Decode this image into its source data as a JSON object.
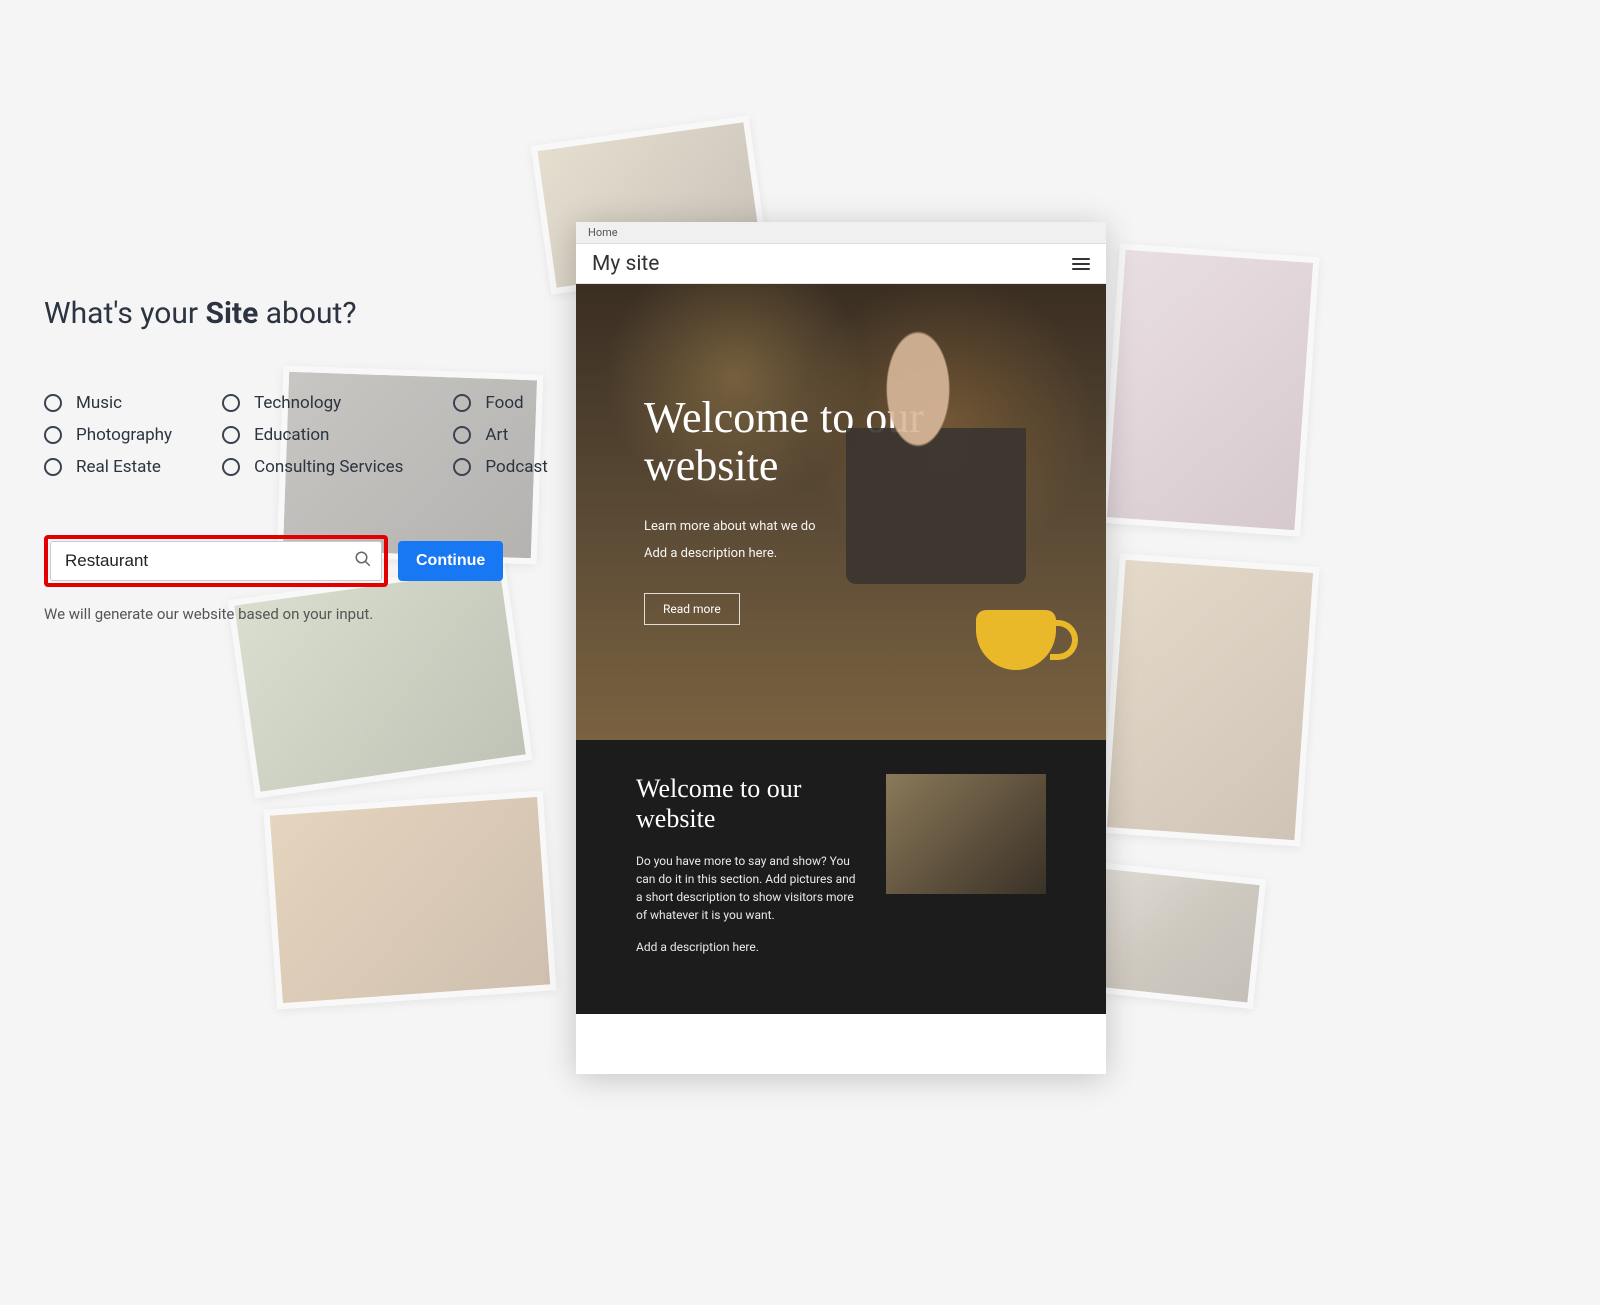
{
  "heading": {
    "pre": "What's your ",
    "strong": "Site",
    "post": " about?"
  },
  "categories": [
    "Music",
    "Technology",
    "Food",
    "Photography",
    "Education",
    "Art",
    "Real Estate",
    "Consulting Services",
    "Podcast"
  ],
  "search": {
    "value": "Restaurant"
  },
  "continue_label": "Continue",
  "helper": "We will generate our website based on your input.",
  "preview": {
    "tab": "Home",
    "site_title": "My site",
    "hero_title": "Welcome to our website",
    "hero_sub1": "Learn more about what we do",
    "hero_sub2": "Add a description here.",
    "hero_btn": "Read more",
    "section_title": "Welcome to our website",
    "section_body": "Do you have more to say and show? You can do it in this section. Add pictures and a short description to show visitors more of whatever it is you want.",
    "section_sub": "Add a description here."
  }
}
